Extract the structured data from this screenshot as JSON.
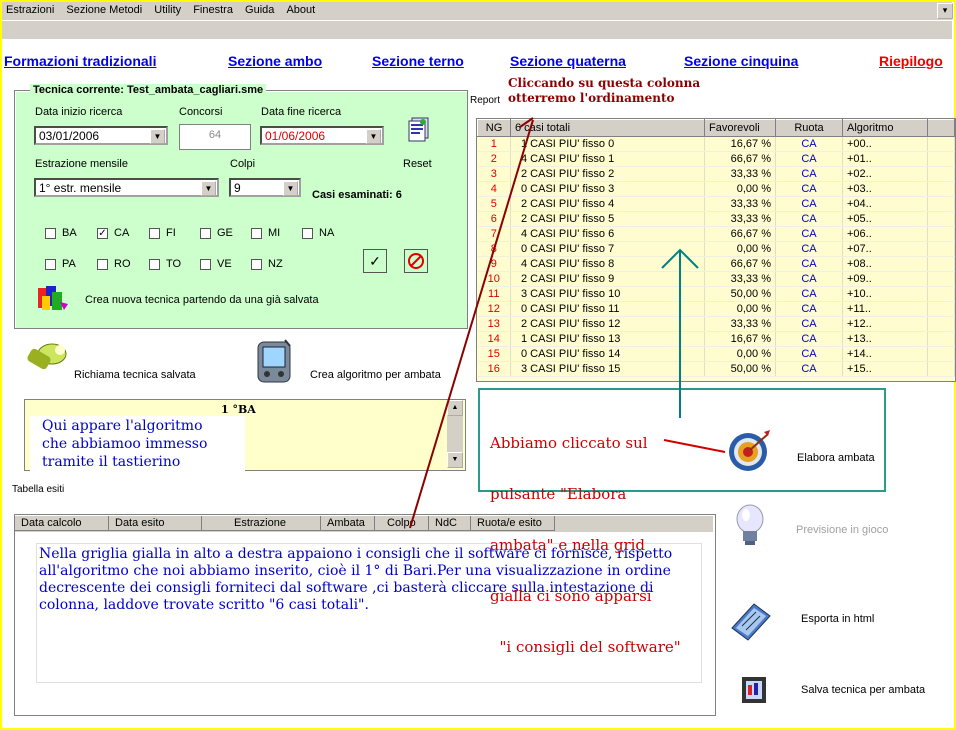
{
  "menu": [
    "Estrazioni",
    "Sezione Metodi",
    "Utility",
    "Finestra",
    "Guida",
    "About"
  ],
  "nav": {
    "tradizionali": "Formazioni tradizionali",
    "ambo": "Sezione ambo",
    "terno": "Sezione terno",
    "quaterna": "Sezione quaterna",
    "cinquina": "Sezione cinquina",
    "riepilogo": "Riepilogo"
  },
  "panel": {
    "title": "Tecnica corrente: Test_ambata_cagliari.sme",
    "data_inizio_label": "Data inizio ricerca",
    "data_inizio_value": "03/01/2006",
    "concorsi_label": "Concorsi",
    "concorsi_value": "64",
    "data_fine_label": "Data fine ricerca",
    "data_fine_value": "01/06/2006",
    "estrazione_label": "Estrazione mensile",
    "estrazione_value": "1° estr. mensile",
    "colpi_label": "Colpi",
    "colpi_value": "9",
    "reset_label": "Reset",
    "casi_label": "Casi esaminati: 6",
    "ruote": [
      {
        "name": "BA",
        "checked": false
      },
      {
        "name": "CA",
        "checked": true
      },
      {
        "name": "FI",
        "checked": false
      },
      {
        "name": "GE",
        "checked": false
      },
      {
        "name": "MI",
        "checked": false
      },
      {
        "name": "NA",
        "checked": false
      },
      {
        "name": "PA",
        "checked": false
      },
      {
        "name": "RO",
        "checked": false
      },
      {
        "name": "TO",
        "checked": false
      },
      {
        "name": "VE",
        "checked": false
      },
      {
        "name": "NZ",
        "checked": false
      }
    ],
    "crea_label": "Crea nuova tecnica partendo da una già salvata"
  },
  "actions": {
    "richiama": "Richiama tecnica salvata",
    "crea_algoritmo": "Crea algoritmo per ambata",
    "elabora": "Elabora ambata",
    "previsione": "Previsione in gioco",
    "esporta": "Esporta in html",
    "salva": "Salva tecnica per ambata"
  },
  "algo_box": {
    "value": "1 °BA",
    "note_lines": [
      "Qui appare l'algoritmo",
      "che abbiamoo immesso",
      "tramite il tastierino"
    ]
  },
  "report": {
    "label": "Report",
    "headers": [
      "NG",
      "6 casi totali",
      "Favorevoli",
      "Ruota",
      "Algoritmo"
    ],
    "rows": [
      [
        "1",
        "1 CASI PIU' fisso 0",
        "16,67 %",
        "CA",
        "+00.."
      ],
      [
        "2",
        "4 CASI PIU' fisso 1",
        "66,67 %",
        "CA",
        "+01.."
      ],
      [
        "3",
        "2 CASI PIU' fisso 2",
        "33,33 %",
        "CA",
        "+02.."
      ],
      [
        "4",
        "0 CASI PIU' fisso 3",
        "0,00 %",
        "CA",
        "+03.."
      ],
      [
        "5",
        "2 CASI PIU' fisso 4",
        "33,33 %",
        "CA",
        "+04.."
      ],
      [
        "6",
        "2 CASI PIU' fisso 5",
        "33,33 %",
        "CA",
        "+05.."
      ],
      [
        "7",
        "4 CASI PIU' fisso 6",
        "66,67 %",
        "CA",
        "+06.."
      ],
      [
        "8",
        "0 CASI PIU' fisso 7",
        "0,00 %",
        "CA",
        "+07.."
      ],
      [
        "9",
        "4 CASI PIU' fisso 8",
        "66,67 %",
        "CA",
        "+08.."
      ],
      [
        "10",
        "2 CASI PIU' fisso 9",
        "33,33 %",
        "CA",
        "+09.."
      ],
      [
        "11",
        "3 CASI PIU' fisso 10",
        "50,00 %",
        "CA",
        "+10.."
      ],
      [
        "12",
        "0 CASI PIU' fisso 11",
        "0,00 %",
        "CA",
        "+11.."
      ],
      [
        "13",
        "2 CASI PIU' fisso 12",
        "33,33 %",
        "CA",
        "+12.."
      ],
      [
        "14",
        "1 CASI PIU' fisso 13",
        "16,67 %",
        "CA",
        "+13.."
      ],
      [
        "15",
        "0 CASI PIU' fisso 14",
        "0,00 %",
        "CA",
        "+14.."
      ],
      [
        "16",
        "3 CASI PIU' fisso 15",
        "50,00 %",
        "CA",
        "+15.."
      ]
    ]
  },
  "annotations": {
    "column_note_lines": [
      "Cliccando su questa colonna",
      "otterremo l'ordinamento"
    ],
    "elabora_note_lines": [
      "Abbiamo cliccato sul",
      "pulsante \"Elabora",
      "ambata\" e nella grid",
      "gialla ci sono apparsi",
      "  \"i consigli del software\""
    ],
    "bottom_note": "Nella griglia gialla in alto a destra appaiono i consigli che il software ci fornisce, rispetto all'algoritmo che noi abbiamo inserito, cioè il 1° di Bari.Per una visualizzazione in ordine decrescente dei consigli forniteci dal software ,ci basterà cliccare sulla intestazione di colonna, laddove trovate scritto \"6 casi totali\"."
  },
  "esiti": {
    "label": "Tabella esiti",
    "headers": [
      "Data calcolo",
      "Data esito",
      "Estrazione",
      "Ambata",
      "Colpo",
      "NdC",
      "Ruota/e esito"
    ]
  },
  "colors": {
    "panel": "#ccffcc",
    "grid": "#fffdd0",
    "annot_red": "#cc0000",
    "annot_blue": "#0000cc",
    "arrow_teal": "#008080",
    "arrow_maroon": "#8b0000"
  }
}
